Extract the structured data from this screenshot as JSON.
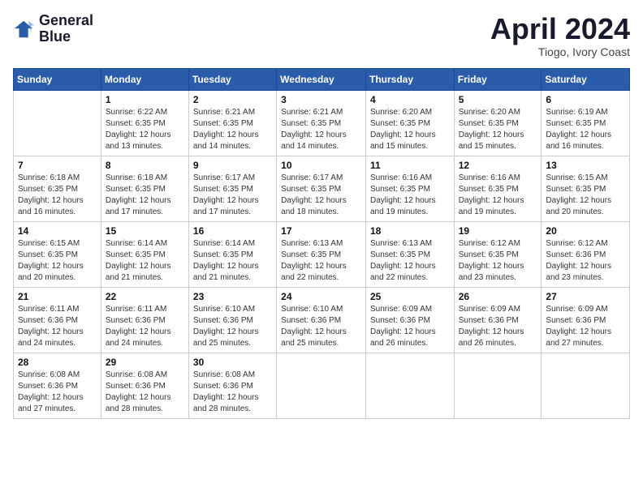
{
  "header": {
    "logo_line1": "General",
    "logo_line2": "Blue",
    "month_title": "April 2024",
    "subtitle": "Tiogo, Ivory Coast"
  },
  "weekdays": [
    "Sunday",
    "Monday",
    "Tuesday",
    "Wednesday",
    "Thursday",
    "Friday",
    "Saturday"
  ],
  "weeks": [
    [
      {
        "day": "",
        "info": ""
      },
      {
        "day": "1",
        "info": "Sunrise: 6:22 AM\nSunset: 6:35 PM\nDaylight: 12 hours\nand 13 minutes."
      },
      {
        "day": "2",
        "info": "Sunrise: 6:21 AM\nSunset: 6:35 PM\nDaylight: 12 hours\nand 14 minutes."
      },
      {
        "day": "3",
        "info": "Sunrise: 6:21 AM\nSunset: 6:35 PM\nDaylight: 12 hours\nand 14 minutes."
      },
      {
        "day": "4",
        "info": "Sunrise: 6:20 AM\nSunset: 6:35 PM\nDaylight: 12 hours\nand 15 minutes."
      },
      {
        "day": "5",
        "info": "Sunrise: 6:20 AM\nSunset: 6:35 PM\nDaylight: 12 hours\nand 15 minutes."
      },
      {
        "day": "6",
        "info": "Sunrise: 6:19 AM\nSunset: 6:35 PM\nDaylight: 12 hours\nand 16 minutes."
      }
    ],
    [
      {
        "day": "7",
        "info": "Sunrise: 6:18 AM\nSunset: 6:35 PM\nDaylight: 12 hours\nand 16 minutes."
      },
      {
        "day": "8",
        "info": "Sunrise: 6:18 AM\nSunset: 6:35 PM\nDaylight: 12 hours\nand 17 minutes."
      },
      {
        "day": "9",
        "info": "Sunrise: 6:17 AM\nSunset: 6:35 PM\nDaylight: 12 hours\nand 17 minutes."
      },
      {
        "day": "10",
        "info": "Sunrise: 6:17 AM\nSunset: 6:35 PM\nDaylight: 12 hours\nand 18 minutes."
      },
      {
        "day": "11",
        "info": "Sunrise: 6:16 AM\nSunset: 6:35 PM\nDaylight: 12 hours\nand 19 minutes."
      },
      {
        "day": "12",
        "info": "Sunrise: 6:16 AM\nSunset: 6:35 PM\nDaylight: 12 hours\nand 19 minutes."
      },
      {
        "day": "13",
        "info": "Sunrise: 6:15 AM\nSunset: 6:35 PM\nDaylight: 12 hours\nand 20 minutes."
      }
    ],
    [
      {
        "day": "14",
        "info": "Sunrise: 6:15 AM\nSunset: 6:35 PM\nDaylight: 12 hours\nand 20 minutes."
      },
      {
        "day": "15",
        "info": "Sunrise: 6:14 AM\nSunset: 6:35 PM\nDaylight: 12 hours\nand 21 minutes."
      },
      {
        "day": "16",
        "info": "Sunrise: 6:14 AM\nSunset: 6:35 PM\nDaylight: 12 hours\nand 21 minutes."
      },
      {
        "day": "17",
        "info": "Sunrise: 6:13 AM\nSunset: 6:35 PM\nDaylight: 12 hours\nand 22 minutes."
      },
      {
        "day": "18",
        "info": "Sunrise: 6:13 AM\nSunset: 6:35 PM\nDaylight: 12 hours\nand 22 minutes."
      },
      {
        "day": "19",
        "info": "Sunrise: 6:12 AM\nSunset: 6:35 PM\nDaylight: 12 hours\nand 23 minutes."
      },
      {
        "day": "20",
        "info": "Sunrise: 6:12 AM\nSunset: 6:36 PM\nDaylight: 12 hours\nand 23 minutes."
      }
    ],
    [
      {
        "day": "21",
        "info": "Sunrise: 6:11 AM\nSunset: 6:36 PM\nDaylight: 12 hours\nand 24 minutes."
      },
      {
        "day": "22",
        "info": "Sunrise: 6:11 AM\nSunset: 6:36 PM\nDaylight: 12 hours\nand 24 minutes."
      },
      {
        "day": "23",
        "info": "Sunrise: 6:10 AM\nSunset: 6:36 PM\nDaylight: 12 hours\nand 25 minutes."
      },
      {
        "day": "24",
        "info": "Sunrise: 6:10 AM\nSunset: 6:36 PM\nDaylight: 12 hours\nand 25 minutes."
      },
      {
        "day": "25",
        "info": "Sunrise: 6:09 AM\nSunset: 6:36 PM\nDaylight: 12 hours\nand 26 minutes."
      },
      {
        "day": "26",
        "info": "Sunrise: 6:09 AM\nSunset: 6:36 PM\nDaylight: 12 hours\nand 26 minutes."
      },
      {
        "day": "27",
        "info": "Sunrise: 6:09 AM\nSunset: 6:36 PM\nDaylight: 12 hours\nand 27 minutes."
      }
    ],
    [
      {
        "day": "28",
        "info": "Sunrise: 6:08 AM\nSunset: 6:36 PM\nDaylight: 12 hours\nand 27 minutes."
      },
      {
        "day": "29",
        "info": "Sunrise: 6:08 AM\nSunset: 6:36 PM\nDaylight: 12 hours\nand 28 minutes."
      },
      {
        "day": "30",
        "info": "Sunrise: 6:08 AM\nSunset: 6:36 PM\nDaylight: 12 hours\nand 28 minutes."
      },
      {
        "day": "",
        "info": ""
      },
      {
        "day": "",
        "info": ""
      },
      {
        "day": "",
        "info": ""
      },
      {
        "day": "",
        "info": ""
      }
    ]
  ]
}
